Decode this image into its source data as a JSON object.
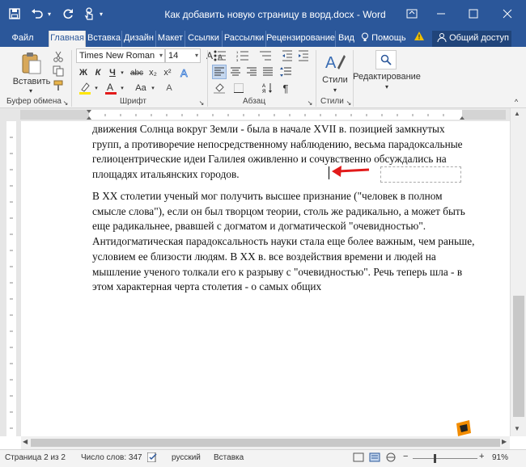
{
  "window": {
    "title": "Как добавить новую страницу в ворд.docx - Word",
    "colors": {
      "titlebar": "#2b579a",
      "accent_arrow": "#e21b1b"
    }
  },
  "quick_access": {
    "save_icon": "save-icon",
    "undo_icon": "undo-icon",
    "redo_icon": "redo-icon",
    "touch_icon": "touch-mode-icon"
  },
  "window_controls": {
    "restore": "restore-icon",
    "minimize": "minimize-icon",
    "maximize": "maximize-icon",
    "close": "close-icon"
  },
  "tabs": [
    {
      "label": "Файл"
    },
    {
      "label": "Главная"
    },
    {
      "label": "Вставка"
    },
    {
      "label": "Дизайн"
    },
    {
      "label": "Макет"
    },
    {
      "label": "Ссылки"
    },
    {
      "label": "Рассылки"
    },
    {
      "label": "Рецензирование"
    },
    {
      "label": "Вид"
    },
    {
      "label": "Помощь"
    },
    {
      "label": "Общий доступ"
    }
  ],
  "ribbon": {
    "clipboard": {
      "paste_label": "Вставить",
      "group_label": "Буфер обмена"
    },
    "font": {
      "name": "Times New Roman",
      "size": "14",
      "group_label": "Шрифт",
      "bold": "Ж",
      "italic": "К",
      "underline": "Ч",
      "strike": "abc",
      "sub": "x₂",
      "sup": "x²",
      "grow": "A",
      "shrink": "A",
      "case": "Aa",
      "clear": "A"
    },
    "paragraph": {
      "group_label": "Абзац"
    },
    "styles": {
      "label": "Стили",
      "group_label": "Стили"
    },
    "editing": {
      "label": "Редактирование"
    }
  },
  "document": {
    "paragraph1": "движения Солнца вокруг Земли - была в начале XVII в. позицией замкнутых групп, а противоречие непосредственному наблюдению, весьма парадоксальные гелиоцентрические идеи Галилея оживленно и сочувственно обсуждались на площадях итальянских городов.",
    "paragraph2": "В XX столетии ученый мог получить высшее признание (\"человек в полном смысле слова\"), если он был творцом теории, столь же радикально, а может быть еще радикальнее, рвавшей с догматом и догматической \"очевидностью\". Антидогматическая парадоксальность науки стала еще более важным, чем раньше, условием ее близости людям. В XX в. все воздействия времени и людей на мышление ученого толкали его к разрыву с \"очевидностью\". Речь теперь шла - в этом характерная черта столетия - о самых общих"
  },
  "status_bar": {
    "page": "Страница 2 из 2",
    "words": "Число слов: 347",
    "language": "русский",
    "mode": "Вставка",
    "zoom": "91%"
  }
}
